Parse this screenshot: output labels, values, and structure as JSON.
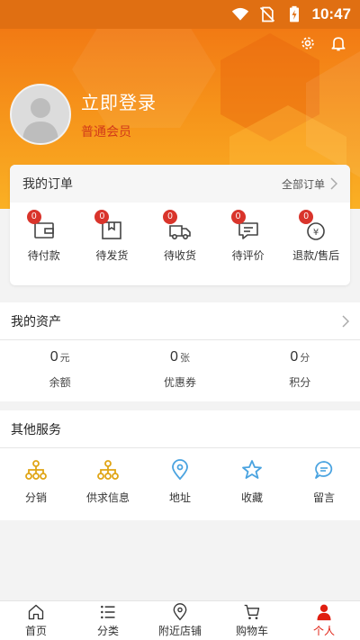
{
  "status_bar": {
    "time": "10:47"
  },
  "profile": {
    "login_label": "立即登录",
    "member_level": "普通会员"
  },
  "orders": {
    "title": "我的订单",
    "all_label": "全部订单",
    "items": [
      {
        "label": "待付款",
        "badge": "0",
        "icon": "wallet-icon"
      },
      {
        "label": "待发货",
        "badge": "0",
        "icon": "package-icon"
      },
      {
        "label": "待收货",
        "badge": "0",
        "icon": "truck-icon"
      },
      {
        "label": "待评价",
        "badge": "0",
        "icon": "comment-icon"
      },
      {
        "label": "退款/售后",
        "badge": "0",
        "icon": "refund-icon"
      }
    ]
  },
  "assets": {
    "title": "我的资产",
    "items": [
      {
        "value": "0",
        "unit": "元",
        "label": "余额"
      },
      {
        "value": "0",
        "unit": "张",
        "label": "优惠券"
      },
      {
        "value": "0",
        "unit": "分",
        "label": "积分"
      }
    ]
  },
  "services": {
    "title": "其他服务",
    "items": [
      {
        "label": "分销",
        "icon": "distribution-icon"
      },
      {
        "label": "供求信息",
        "icon": "supply-demand-icon"
      },
      {
        "label": "地址",
        "icon": "location-icon"
      },
      {
        "label": "收藏",
        "icon": "star-icon"
      },
      {
        "label": "留言",
        "icon": "message-icon"
      }
    ]
  },
  "nav": {
    "items": [
      {
        "label": "首页",
        "icon": "home-icon"
      },
      {
        "label": "分类",
        "icon": "list-icon"
      },
      {
        "label": "附近店铺",
        "icon": "location-pin-icon"
      },
      {
        "label": "购物车",
        "icon": "cart-icon"
      },
      {
        "label": "个人",
        "icon": "person-icon",
        "active": true
      }
    ]
  },
  "colors": {
    "accent": "#f6931a",
    "badge": "#d9342b",
    "nav_active": "#e01e10",
    "service_yellow": "#e0a516",
    "service_blue": "#4aa3e0"
  }
}
